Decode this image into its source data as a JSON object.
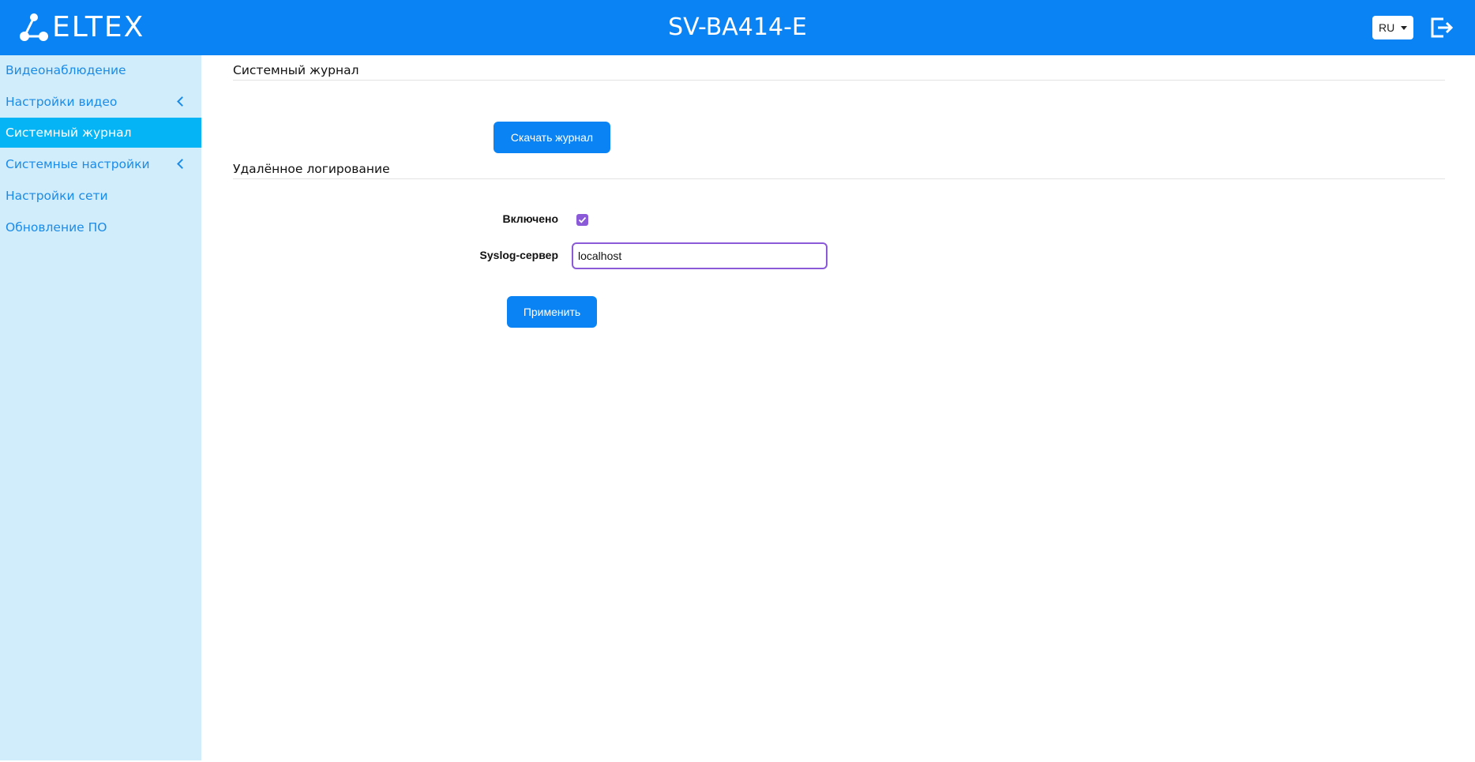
{
  "header": {
    "logo_text": "ELTEX",
    "device_title": "SV-BA414-E",
    "language": "RU",
    "colors": {
      "bar": "#0a84f5"
    }
  },
  "sidebar": {
    "items": [
      {
        "label": "Видеонаблюдение",
        "active": false,
        "has_submenu": false
      },
      {
        "label": "Настройки видео",
        "active": false,
        "has_submenu": true
      },
      {
        "label": "Системный журнал",
        "active": true,
        "has_submenu": false
      },
      {
        "label": "Системные настройки",
        "active": false,
        "has_submenu": true
      },
      {
        "label": "Настройки сети",
        "active": false,
        "has_submenu": false
      },
      {
        "label": "Обновление ПО",
        "active": false,
        "has_submenu": false
      }
    ]
  },
  "main": {
    "syslog_section": {
      "title": "Системный журнал",
      "download_button": "Скачать журнал"
    },
    "remote_section": {
      "title": "Удалённое логирование",
      "enabled_label": "Включено",
      "enabled": true,
      "server_label": "Syslog-сервер",
      "server_value": "localhost",
      "apply_button": "Применить"
    }
  },
  "icons": {
    "logo": "eltex-logo-icon",
    "logout": "logout-icon",
    "dropdown": "caret-down-icon",
    "submenu": "chevron-left-icon",
    "check": "check-icon"
  }
}
